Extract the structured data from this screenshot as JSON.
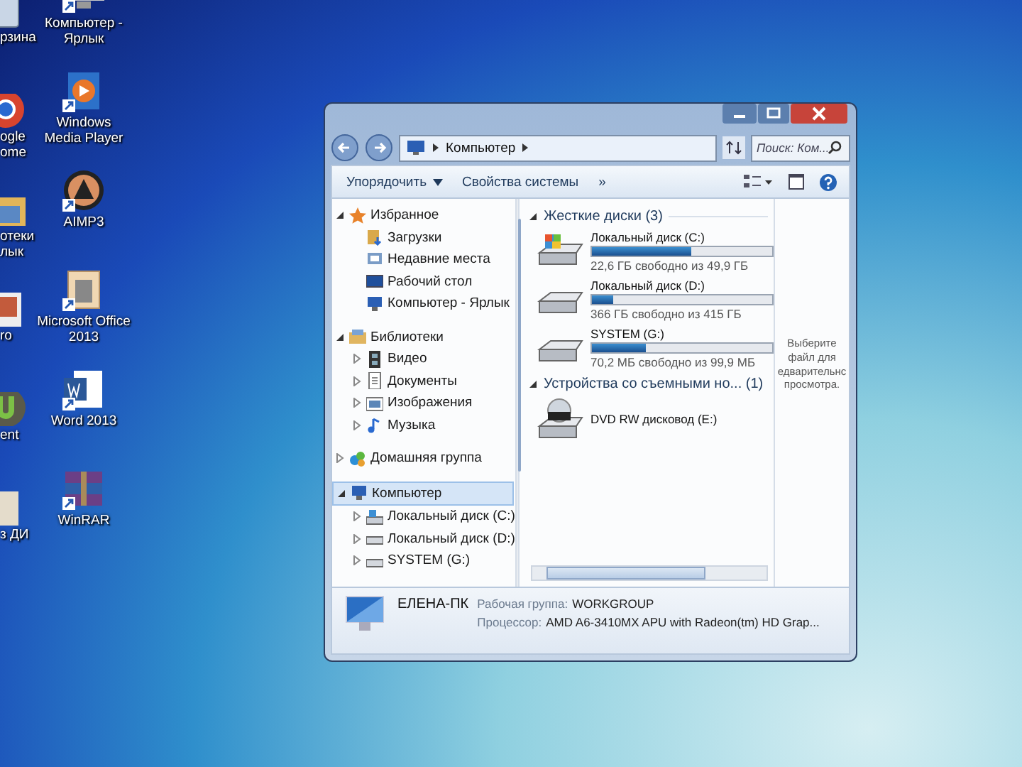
{
  "desktop": {
    "icons": [
      {
        "label": "рзина",
        "kind": "recycle"
      },
      {
        "label": "Компьютер - Ярлык",
        "kind": "computer"
      },
      {
        "label": "ogle ome",
        "kind": "chrome"
      },
      {
        "label": "Windows Media Player",
        "kind": "media"
      },
      {
        "label": "отеки лык",
        "kind": "library"
      },
      {
        "label": "AIMP3",
        "kind": "aimp"
      },
      {
        "label": "ro",
        "kind": "photo"
      },
      {
        "label": "Microsoft Office 2013",
        "kind": "office"
      },
      {
        "label": "ent",
        "kind": "torrent"
      },
      {
        "label": "Word 2013",
        "kind": "word"
      },
      {
        "label": "з ДИ",
        "kind": "document"
      },
      {
        "label": "WinRAR",
        "kind": "winrar"
      }
    ]
  },
  "window": {
    "address": "Компьютер",
    "search": {
      "placeholder": "Поиск: Ком..."
    },
    "toolbar": {
      "organize": "Упорядочить",
      "properties": "Свойства системы",
      "more": "»"
    },
    "sidebar": {
      "items": [
        {
          "label": "Избранное",
          "kind": "star",
          "expanded": true,
          "selected": false,
          "children": [
            {
              "label": "Загрузки",
              "kind": "downloads",
              "selected": false
            },
            {
              "label": "Недавние места",
              "kind": "recent",
              "selected": false
            },
            {
              "label": "Рабочий стол",
              "kind": "desktop",
              "selected": false
            },
            {
              "label": "Компьютер - Ярлык",
              "kind": "computer",
              "selected": false
            }
          ]
        },
        {
          "label": "Библиотеки",
          "kind": "library",
          "expanded": true,
          "selected": false,
          "children": [
            {
              "label": "Видео",
              "kind": "video",
              "expanded": false,
              "selected": false
            },
            {
              "label": "Документы",
              "kind": "document",
              "expanded": false,
              "selected": false
            },
            {
              "label": "Изображения",
              "kind": "image",
              "expanded": false,
              "selected": false
            },
            {
              "label": "Музыка",
              "kind": "music",
              "expanded": false,
              "selected": false
            }
          ]
        },
        {
          "label": "Домашняя группа",
          "kind": "homegroup",
          "expanded": false,
          "selected": false
        },
        {
          "label": "Компьютер",
          "kind": "computer",
          "expanded": true,
          "selected": true,
          "children": [
            {
              "label": "Локальный диск (C:)",
              "kind": "sysdrive",
              "expanded": false,
              "selected": false
            },
            {
              "label": "Локальный диск (D:)",
              "kind": "drive",
              "expanded": false,
              "selected": false
            },
            {
              "label": "SYSTEM (G:)",
              "kind": "drive",
              "expanded": false,
              "selected": false
            }
          ]
        }
      ]
    },
    "groups": [
      {
        "title": "Жесткие диски (3)",
        "expanded": true,
        "items": [
          {
            "name": "Локальный диск (C:)",
            "kind": "sysdrive",
            "level": 0.55,
            "free": "22,6 ГБ свободно из 49,9 ГБ"
          },
          {
            "name": "Локальный диск (D:)",
            "kind": "drive",
            "level": 0.12,
            "free": "366 ГБ свободно из 415 ГБ"
          },
          {
            "name": "SYSTEM (G:)",
            "kind": "drive",
            "level": 0.3,
            "free": "70,2 МБ свободно из 99,9 МБ"
          }
        ]
      },
      {
        "title": "Устройства со съемными но... (1)",
        "expanded": true,
        "items": [
          {
            "name": "DVD RW дисковод (E:)",
            "kind": "dvd"
          }
        ]
      }
    ],
    "preview_hint": "Выберите файл для едварительнс просмотра.",
    "details": {
      "name": "ЕЛЕНА-ПК",
      "fields": [
        {
          "label": "Рабочая группа:",
          "value": "WORKGROUP"
        },
        {
          "label": "Процессор:",
          "value": "AMD A6-3410MX APU with Radeon(tm) HD Grap..."
        }
      ]
    }
  }
}
